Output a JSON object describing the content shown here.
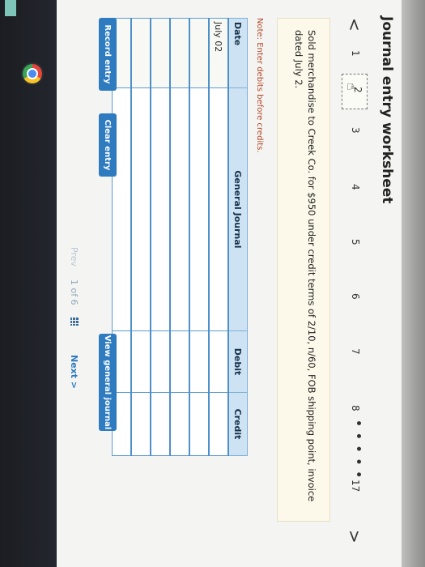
{
  "worksheet": {
    "title": "Journal entry worksheet"
  },
  "navigation": {
    "prev_arrow": "<",
    "next_arrow": ">",
    "steps": [
      "1",
      "2",
      "3",
      "4",
      "5",
      "6",
      "7",
      "8"
    ],
    "active_step": "2",
    "ellipsis": "• • • • •",
    "last_step": "17"
  },
  "question": {
    "text": "Sold merchandise to Creek Co. for $950 under credit terms of 2/10, n/60, FOB shipping point, invoice dated July 2."
  },
  "note": "Note: Enter debits before credits.",
  "journal": {
    "headers": {
      "date": "Date",
      "account": "General Journal",
      "debit": "Debit",
      "credit": "Credit"
    },
    "rows": [
      {
        "date": "July 02",
        "account": "",
        "debit": "",
        "credit": ""
      },
      {
        "date": "",
        "account": "",
        "debit": "",
        "credit": ""
      },
      {
        "date": "",
        "account": "",
        "debit": "",
        "credit": ""
      },
      {
        "date": "",
        "account": "",
        "debit": "",
        "credit": ""
      },
      {
        "date": "",
        "account": "",
        "debit": "",
        "credit": ""
      },
      {
        "date": "",
        "account": "",
        "debit": "",
        "credit": ""
      }
    ]
  },
  "buttons": {
    "record": "Record entry",
    "clear": "Clear entry",
    "view": "View general journal"
  },
  "pager": {
    "prev": "Prev",
    "count": "1 of 6",
    "next": "Next >"
  },
  "colors": {
    "button_blue": "#2e7bc0",
    "header_blue": "#cde3f3",
    "note_red": "#b24b2b"
  }
}
